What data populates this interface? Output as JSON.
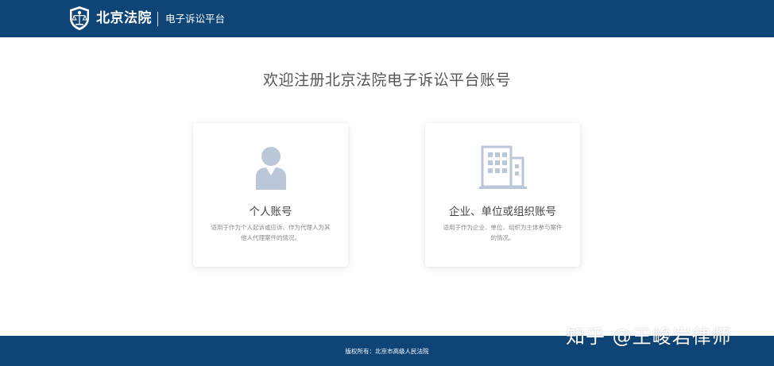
{
  "header": {
    "brand": "北京法院",
    "subtitle": "电子诉讼平台",
    "background_color": "#0f4476"
  },
  "main": {
    "title": "欢迎注册北京法院电子诉讼平台账号",
    "cards": [
      {
        "icon": "person-icon",
        "title": "个人账号",
        "description": "适用于作为个人起诉或应诉、作为代理人为其他人代理案件的情况。"
      },
      {
        "icon": "building-icon",
        "title": "企业、单位或组织账号",
        "description": "适用于作为企业、单位、组织为主体参与案件的情况。"
      }
    ],
    "icon_color": "#b9c7d8"
  },
  "footer": {
    "copyright": "版权所有：北京市高级人民法院"
  },
  "watermark": {
    "text": "知乎 @王峻岩律师"
  }
}
